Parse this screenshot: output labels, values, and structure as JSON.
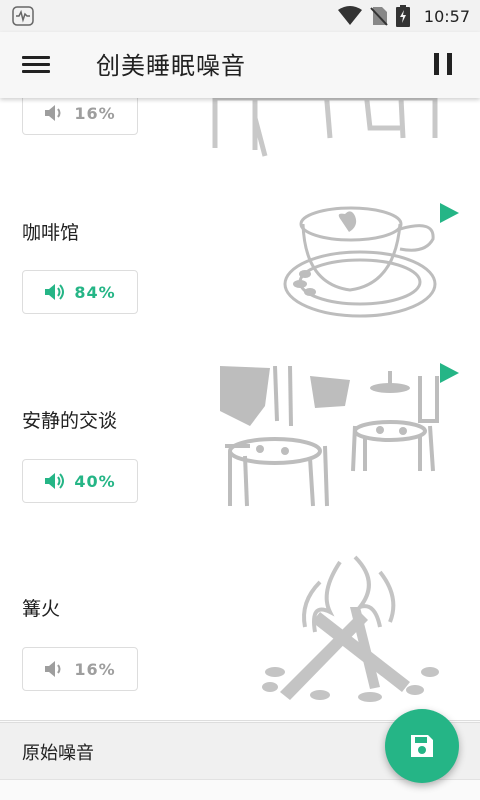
{
  "status_bar": {
    "time": "10:57"
  },
  "app_bar": {
    "title": "创美睡眠噪音"
  },
  "sounds": [
    {
      "label": "",
      "volume": "16%",
      "active": false
    },
    {
      "label": "咖啡馆",
      "volume": "84%",
      "active": true
    },
    {
      "label": "安静的交谈",
      "volume": "40%",
      "active": true
    },
    {
      "label": "篝火",
      "volume": "16%",
      "active": false
    }
  ],
  "section": {
    "title": "原始噪音"
  },
  "colors": {
    "accent": "#25b586",
    "inactive": "#9e9e9e"
  }
}
